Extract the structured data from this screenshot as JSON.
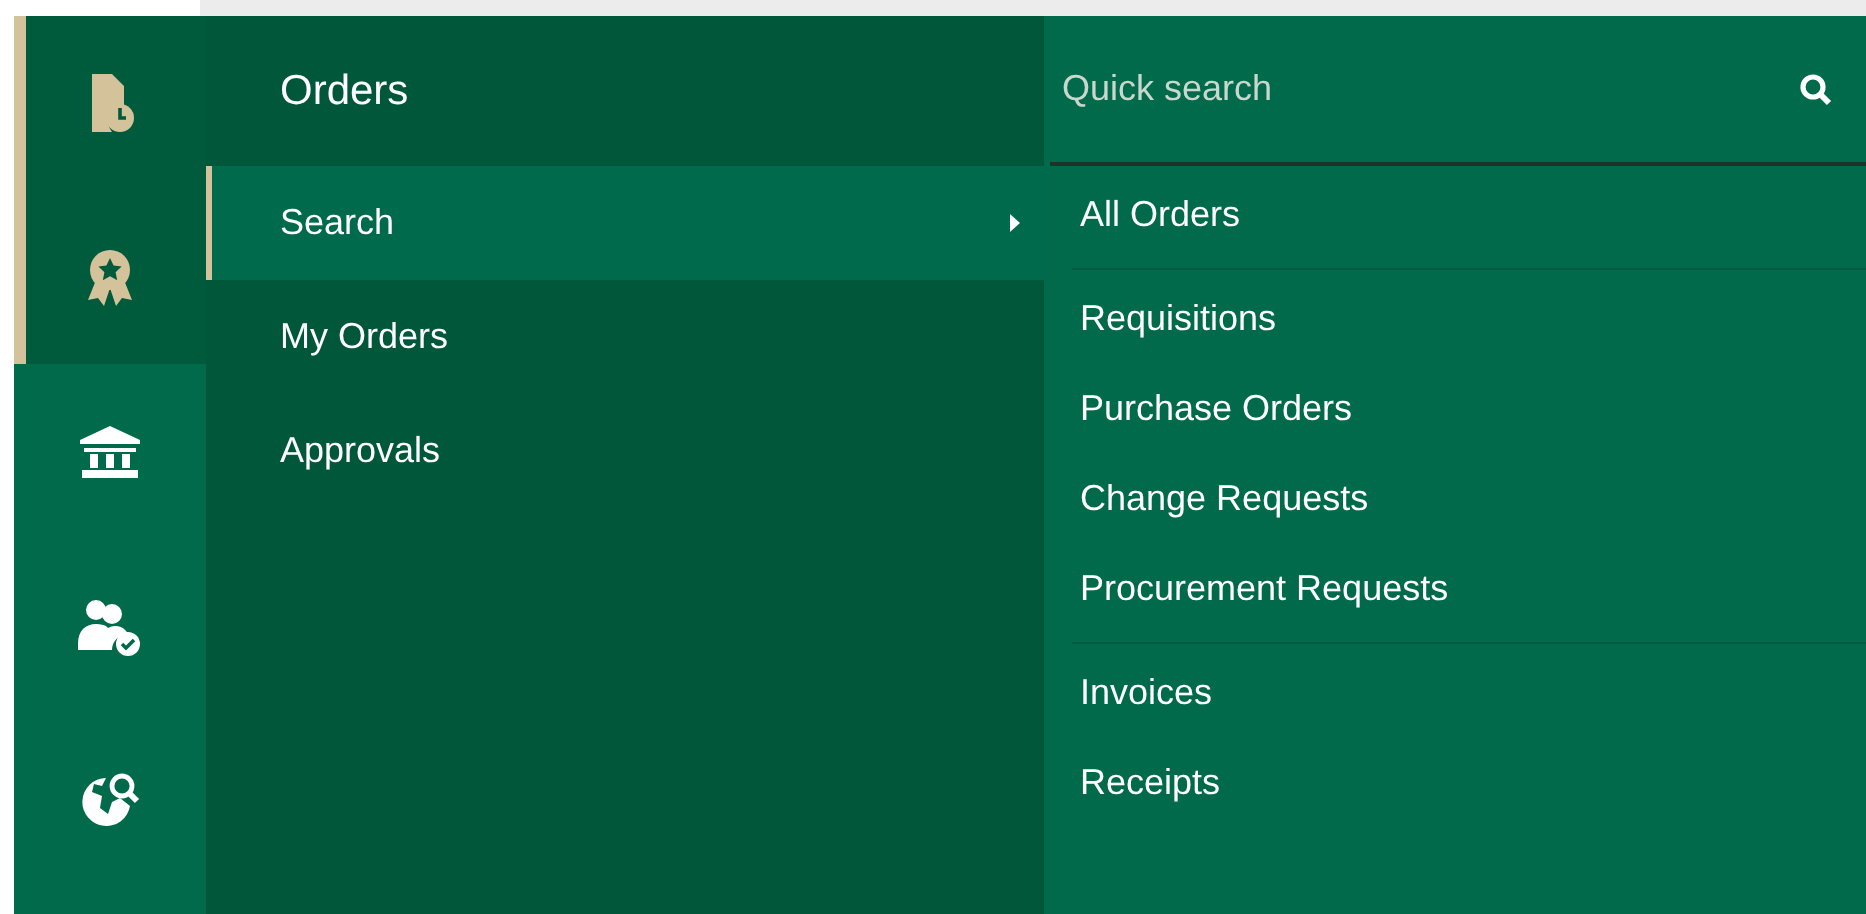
{
  "rail": {
    "items": [
      {
        "kind": "document-clock",
        "selected": true
      },
      {
        "kind": "award",
        "selected": true
      },
      {
        "kind": "bank",
        "selected": false
      },
      {
        "kind": "users-check",
        "selected": false
      },
      {
        "kind": "globe-search",
        "selected": false
      }
    ]
  },
  "menu": {
    "title": "Orders",
    "items": [
      {
        "label": "Search",
        "selected": true,
        "has_submenu": true
      },
      {
        "label": "My Orders",
        "selected": false,
        "has_submenu": false
      },
      {
        "label": "Approvals",
        "selected": false,
        "has_submenu": false
      }
    ]
  },
  "submenu": {
    "search": {
      "placeholder": "Quick search"
    },
    "groups": [
      {
        "items": [
          {
            "label": "All Orders"
          }
        ]
      },
      {
        "items": [
          {
            "label": "Requisitions"
          },
          {
            "label": "Purchase Orders"
          },
          {
            "label": "Change Requests"
          },
          {
            "label": "Procurement Requests"
          }
        ]
      },
      {
        "items": [
          {
            "label": "Invoices"
          },
          {
            "label": "Receipts"
          }
        ]
      }
    ]
  }
}
